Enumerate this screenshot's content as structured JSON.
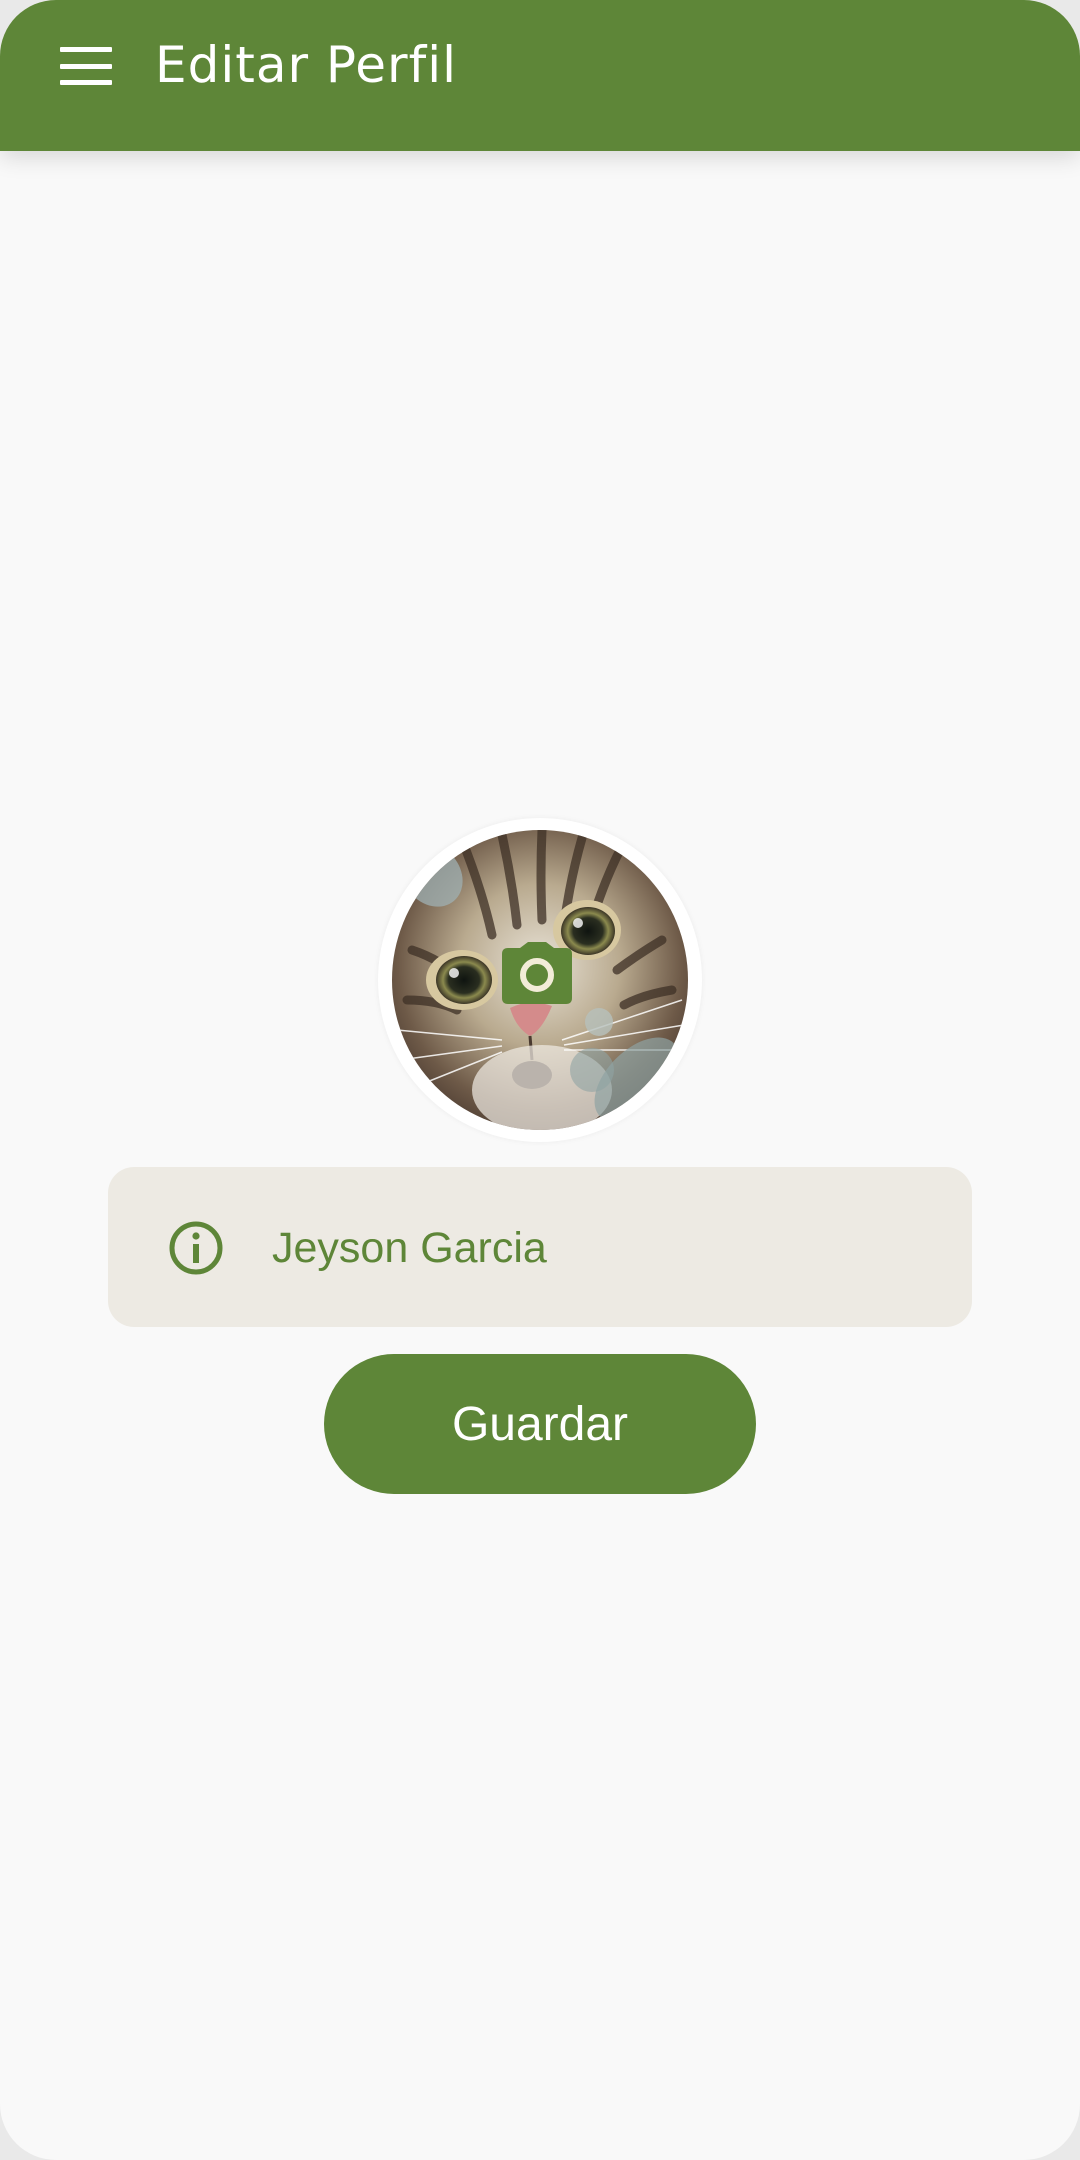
{
  "app_bar": {
    "title": "Editar Perfil",
    "menu_icon": "hamburger-menu-icon"
  },
  "profile": {
    "avatar_description_icon": "cat-avatar",
    "camera_icon": "camera-icon",
    "name_field": {
      "icon": "info-icon",
      "value": "Jeyson Garcia"
    }
  },
  "actions": {
    "save_label": "Guardar"
  },
  "colors": {
    "primary": "#5e8638",
    "field_background": "#edeae3",
    "background": "#f9f9f9"
  }
}
